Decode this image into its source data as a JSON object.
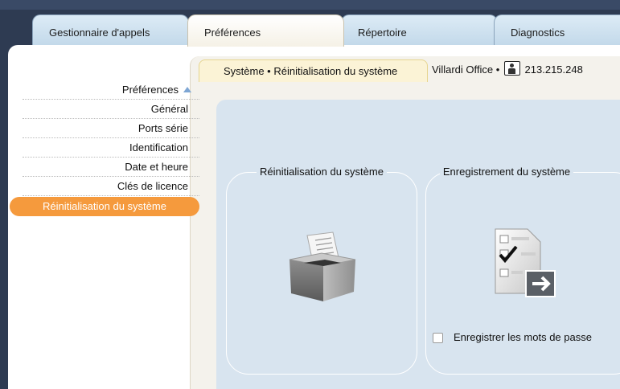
{
  "tabs": [
    {
      "label": "Gestionnaire d'appels",
      "active": false
    },
    {
      "label": "Préférences",
      "active": true
    },
    {
      "label": "Répertoire",
      "active": false
    },
    {
      "label": "Diagnostics",
      "active": false
    }
  ],
  "sidebar": {
    "header": "Préférences",
    "items": [
      {
        "label": "Général"
      },
      {
        "label": "Ports série"
      },
      {
        "label": "Identification"
      },
      {
        "label": "Date et heure"
      },
      {
        "label": "Clés de licence"
      },
      {
        "label": "Réinitialisation du système",
        "active": true
      }
    ]
  },
  "breadcrumb": {
    "path": "Système • Réinitialisation du système",
    "site": "Villardi Office •",
    "ip": "213.215.248"
  },
  "sections": {
    "reset": {
      "title": "Réinitialisation du système",
      "icon": "archive-box-icon"
    },
    "save": {
      "title": "Enregistrement du système",
      "icon": "checklist-export-icon",
      "checkbox_label": "Enregistrer les mots de passe",
      "checkbox_checked": false
    }
  },
  "colors": {
    "accent": "#f59a3d",
    "chrome": "#2e3b52",
    "inner_panel": "#d8e4ef"
  }
}
